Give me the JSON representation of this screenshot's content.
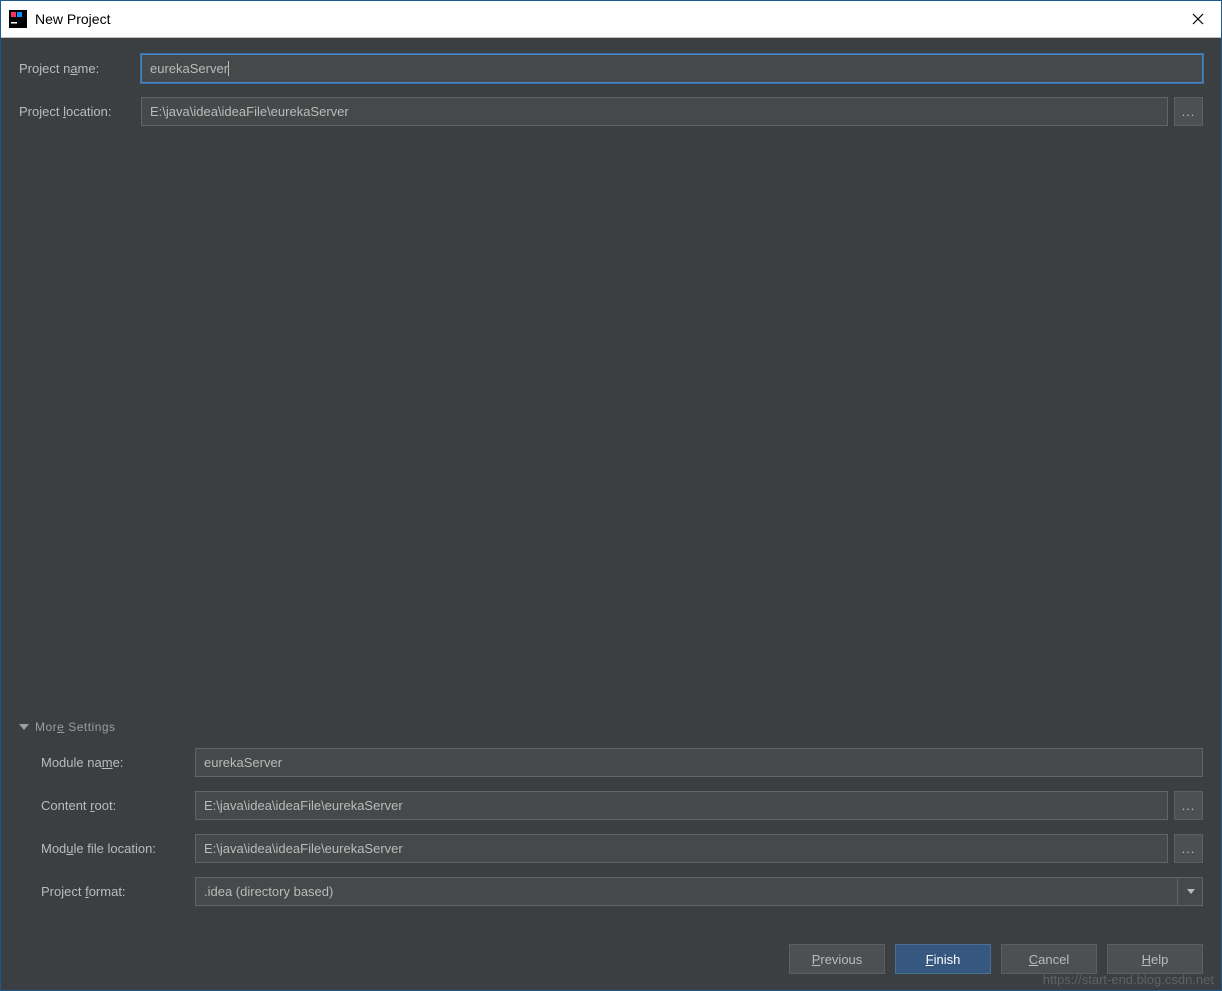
{
  "window": {
    "title": "New Project"
  },
  "form": {
    "project_name_label": "Project name:",
    "project_name_value": "eurekaServer",
    "project_location_label": "Project location:",
    "project_location_value": "E:\\java\\idea\\ideaFile\\eurekaServer"
  },
  "more_settings": {
    "header": "More Settings",
    "module_name_label": "Module name:",
    "module_name_value": "eurekaServer",
    "content_root_label": "Content root:",
    "content_root_value": "E:\\java\\idea\\ideaFile\\eurekaServer",
    "module_file_location_label": "Module file location:",
    "module_file_location_value": "E:\\java\\idea\\ideaFile\\eurekaServer",
    "project_format_label": "Project format:",
    "project_format_value": ".idea (directory based)"
  },
  "buttons": {
    "previous": "revious",
    "previous_u": "P",
    "finish": "inish",
    "finish_u": "F",
    "cancel": "ancel",
    "cancel_u": "C",
    "help": "elp",
    "help_u": "H"
  },
  "browse_label": "...",
  "watermark": "https://start-end.blog.csdn.net"
}
